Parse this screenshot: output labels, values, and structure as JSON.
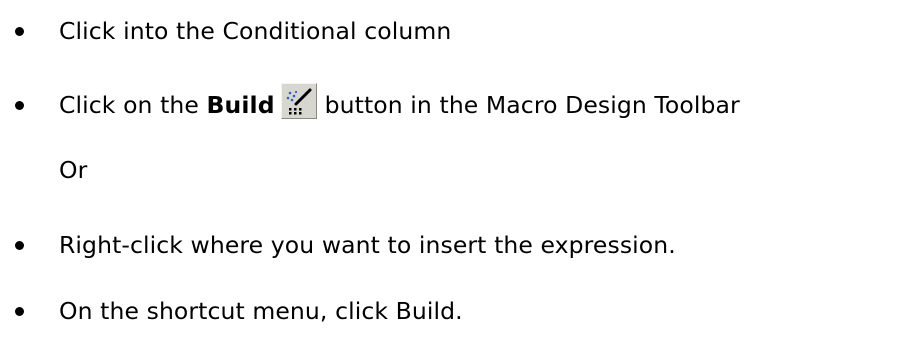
{
  "steps": [
    {
      "text": "Click into the Conditional column"
    },
    {
      "prefix": "Click on the ",
      "bold": "Build",
      "icon": "build-wand-icon",
      "suffix": "button in the Macro Design Toolbar"
    },
    {
      "text": "Or"
    },
    {
      "text": "Right-click where you want to insert the expression."
    },
    {
      "text": "On the shortcut menu, click Build."
    }
  ]
}
